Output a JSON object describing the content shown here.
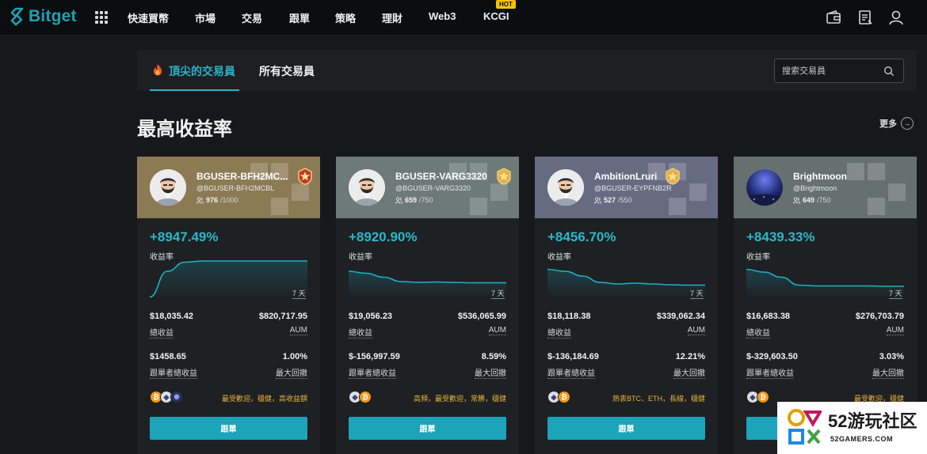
{
  "brand": {
    "name": "Bitget",
    "accent": "#1da2b4"
  },
  "nav": {
    "items": [
      "快速買幣",
      "市場",
      "交易",
      "跟單",
      "策略",
      "理財",
      "Web3",
      "KCGI"
    ],
    "hot_badge": "HOT",
    "right_icons": [
      "wallet-icon",
      "orders-icon",
      "user-icon"
    ]
  },
  "tabs": {
    "items": [
      "頂尖的交易員",
      "所有交易員"
    ],
    "active": 0
  },
  "search": {
    "placeholder": "搜索交易員"
  },
  "section": {
    "title": "最高收益率",
    "more_label": "更多"
  },
  "traders": [
    {
      "name": "BGUSER-BFH2MC...",
      "handle": "@BGUSER-BFH2MCBL",
      "followers": "976",
      "capacity": "/1000",
      "roi": "+8947.49%",
      "roi_label": "收益率",
      "period": "7 天",
      "stats": [
        {
          "value": "$18,035.42",
          "label": "總收益"
        },
        {
          "value": "$820,717.95",
          "label": "AUM"
        },
        {
          "value": "$1458.65",
          "label": "跟單者總收益"
        },
        {
          "value": "1.00%",
          "label": "最大回撤"
        }
      ],
      "coins": [
        "btc",
        "eth",
        "dot"
      ],
      "tags": "最受歡迎，穩健，高收益額",
      "button": "跟單",
      "header_color": "#8c7a55",
      "medal": "gold-red-medal-icon",
      "curve": [
        0.05,
        0.7,
        0.93,
        0.96,
        0.96,
        0.96,
        0.96,
        0.96,
        0.96,
        0.96
      ]
    },
    {
      "name": "BGUSER-VARG3320",
      "handle": "@BGUSER-VARG3320",
      "followers": "659",
      "capacity": "/750",
      "roi": "+8920.90%",
      "roi_label": "收益率",
      "period": "7 天",
      "stats": [
        {
          "value": "$19,056.23",
          "label": "總收益"
        },
        {
          "value": "$536,065.99",
          "label": "AUM"
        },
        {
          "value": "$-156,997.59",
          "label": "跟單者總收益"
        },
        {
          "value": "8.59%",
          "label": "最大回撤"
        }
      ],
      "coins": [
        "eth",
        "btc"
      ],
      "tags": "高頻，最受歡迎，常勝，穩健",
      "button": "跟單",
      "header_color": "#6d7a78",
      "medal": "gold-medal-icon",
      "curve": [
        0.7,
        0.65,
        0.55,
        0.44,
        0.42,
        0.43,
        0.42,
        0.41,
        0.41,
        0.41
      ]
    },
    {
      "name": "AmbitionLruri",
      "handle": "@BGUSER-EYPFNB2R",
      "followers": "527",
      "capacity": "/550",
      "roi": "+8456.70%",
      "roi_label": "收益率",
      "period": "7 天",
      "stats": [
        {
          "value": "$18,118.38",
          "label": "總收益"
        },
        {
          "value": "$339,062.34",
          "label": "AUM"
        },
        {
          "value": "$-136,184.69",
          "label": "跟單者總收益"
        },
        {
          "value": "12.21%",
          "label": "最大回撤"
        }
      ],
      "coins": [
        "eth",
        "btc"
      ],
      "tags": "熱衷BTC、ETH，長線，穩健",
      "button": "跟單",
      "header_color": "#676b82",
      "medal": "gold-medal-icon",
      "curve": [
        0.75,
        0.7,
        0.58,
        0.42,
        0.38,
        0.4,
        0.38,
        0.36,
        0.35,
        0.35
      ]
    },
    {
      "name": "Brightmoon",
      "handle": "@Brightmoon",
      "followers": "649",
      "capacity": "/750",
      "roi": "+8439.33%",
      "roi_label": "收益率",
      "period": "7 天",
      "stats": [
        {
          "value": "$16,683.38",
          "label": "總收益"
        },
        {
          "value": "$276,703.79",
          "label": "AUM"
        },
        {
          "value": "$-329,603.50",
          "label": "跟單者總收益"
        },
        {
          "value": "3.03%",
          "label": "最大回撤"
        }
      ],
      "coins": [
        "eth",
        "btc"
      ],
      "tags": "最受歡迎，穩健",
      "button": "跟單",
      "header_color": "#66716f",
      "medal": "",
      "curve": [
        0.75,
        0.68,
        0.55,
        0.35,
        0.33,
        0.33,
        0.33,
        0.33,
        0.32,
        0.32
      ]
    }
  ],
  "watermark": {
    "big": "52游玩社区",
    "small": "52GAMERS.COM"
  }
}
